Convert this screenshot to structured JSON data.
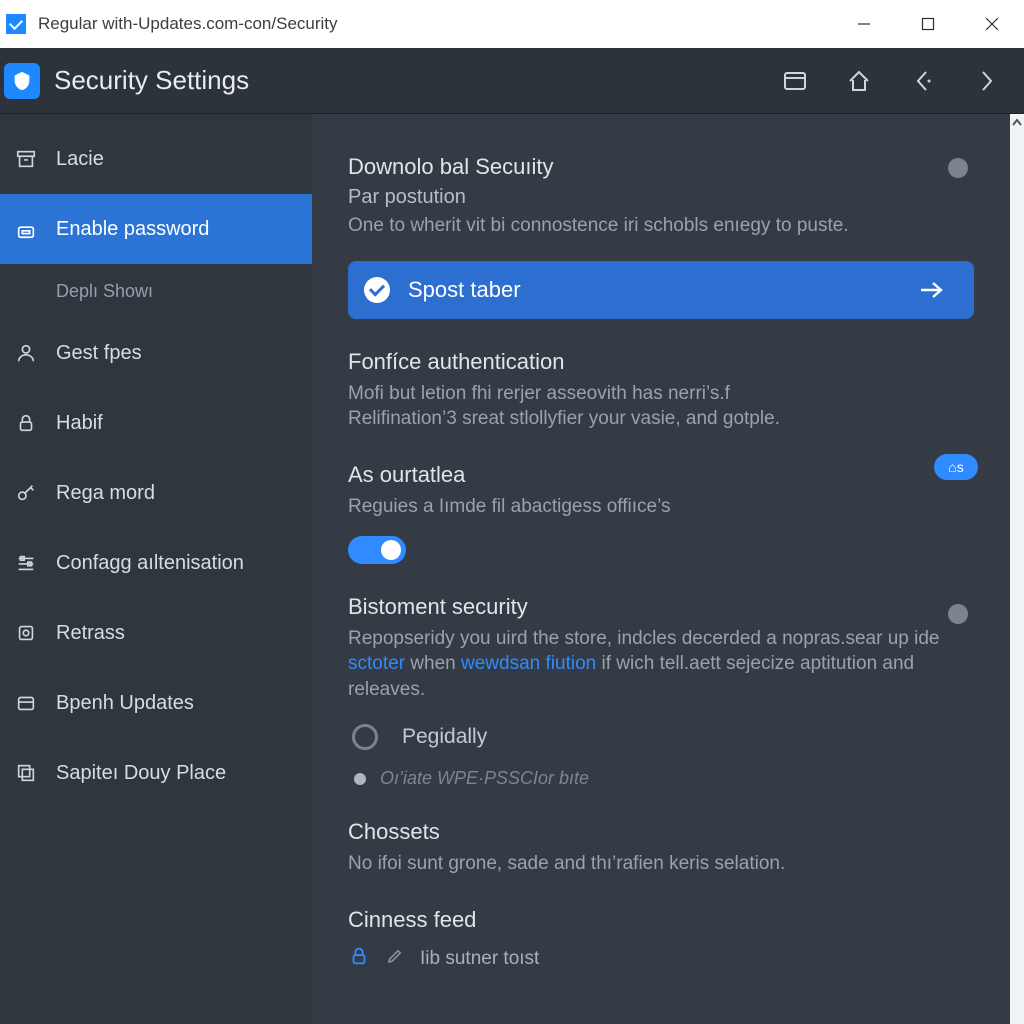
{
  "window": {
    "title": "Regular with-Updates.com-con/Security"
  },
  "header": {
    "title": "Security Settings",
    "actions": {
      "panel": "panel",
      "home": "home",
      "back": "back",
      "forward": "forward"
    }
  },
  "sidebar": {
    "items": [
      {
        "label": "Lacie",
        "icon": "archive"
      },
      {
        "label": "Enable password",
        "icon": "lock",
        "selected": true
      },
      {
        "label": "Deplı Showı",
        "sub": true
      },
      {
        "label": "Gest fpes",
        "icon": "user"
      },
      {
        "label": "Habif",
        "icon": "padlock"
      },
      {
        "label": "Rega mord",
        "icon": "key"
      },
      {
        "label": "Confagg aıltenisation",
        "icon": "sliders"
      },
      {
        "label": "Retrass",
        "icon": "target"
      },
      {
        "label": "Bpenh Updates",
        "icon": "folder"
      },
      {
        "label": "Sapiteı Douy Place",
        "icon": "copy"
      }
    ]
  },
  "main": {
    "sec1": {
      "title": "Downolo bal Secuıity",
      "sub": "Par postution",
      "desc": "One to wherit vit bi connostence iri schobls enıegy to puste."
    },
    "primary": {
      "label": "Spost taber"
    },
    "sec2": {
      "title": "Fonfíce authentication",
      "desc_l1": "Mofi but letion fhi rerjer asseovith has nerri’s.f",
      "desc_l2": "Relifination’3 sreat stlollyfier your vasie, and gotple."
    },
    "sec3": {
      "title": "As ourtatlea",
      "desc": "Reguies a Iımde fil abactigess offiıce’s",
      "badge": "⌂s"
    },
    "sec4": {
      "title": "Bistoment security",
      "desc_pre": "Repopseridy you uird the store, indcles decerded a nopras.sear up ide ",
      "link1": "sctoter",
      "mid": " when ",
      "link2": "wewdsan fiution",
      "desc_post": " if wich tell.aett sejecize aptitution and releaves."
    },
    "radio": {
      "label": "Pegidally"
    },
    "small": {
      "text": "Oı’iate WPE·PSSCIor bıte"
    },
    "sec5": {
      "title": "Chossets",
      "desc": "No ifoi sunt grone, sade and thı’rafien keris selation."
    },
    "sec6": {
      "title": "Cinness feed",
      "feed": "Iib sutner toıst"
    }
  },
  "colors": {
    "accent": "#2f8bff",
    "accent_dk": "#2d6fd0"
  }
}
